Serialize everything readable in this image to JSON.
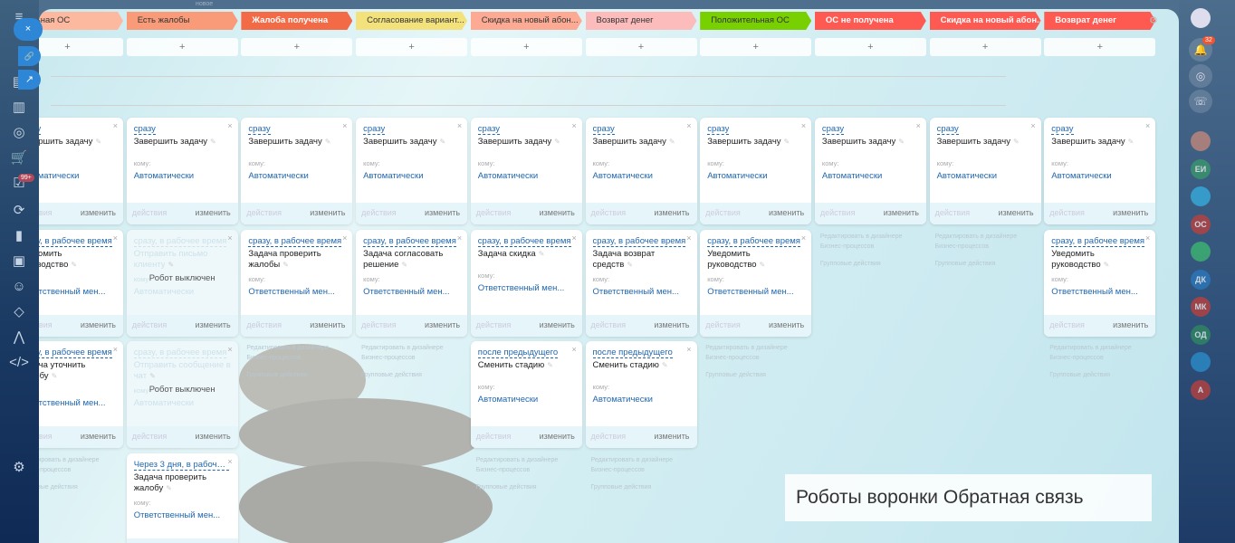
{
  "header_partial": "новое",
  "stages": [
    {
      "label": "тельная ОС",
      "color": "#fdb8a0",
      "text": "#333"
    },
    {
      "label": "Есть жалобы",
      "color": "#f99a78",
      "text": "#333"
    },
    {
      "label": "Жалоба получена",
      "color": "#f36a47",
      "text": "#fff"
    },
    {
      "label": "Согласование вариант...",
      "color": "#f3e27c",
      "text": "#333"
    },
    {
      "label": "Скидка на новый абон...",
      "color": "#fcaa93",
      "text": "#333"
    },
    {
      "label": "Возврат денег",
      "color": "#fcbcbc",
      "text": "#333"
    },
    {
      "label": "Положительная ОС",
      "color": "#78d000",
      "text": "#333"
    },
    {
      "label": "ОС не получена",
      "color": "#ff5a52",
      "text": "#fff"
    },
    {
      "label": "Скидка на новый абон...",
      "color": "#ff5a52",
      "text": "#fff"
    },
    {
      "label": "Возврат денег",
      "color": "#ff5a52",
      "text": "#fff"
    }
  ],
  "add_label": "+",
  "labels": {
    "who": "кому:",
    "actions": "действия",
    "edit": "изменить",
    "off": "Робот выключен",
    "designer": "Редактировать в дизайнере Бизнес-процессов",
    "group": "Групповые действия",
    "close": "×",
    "pen": "✎"
  },
  "columns": [
    [
      {
        "cond": "сразу",
        "title": "Завершить задачу",
        "who": "Автоматически"
      },
      {
        "cond": "сразу, в рабочее время",
        "title": "Уведомить руководство",
        "who": "Ответственный мен..."
      },
      {
        "cond": "сразу, в рабочее время",
        "title": "Задача уточнить жалобу",
        "who": "Ответственный мен..."
      },
      {
        "links": true
      }
    ],
    [
      {
        "cond": "сразу",
        "title": "Завершить задачу",
        "who": "Автоматически"
      },
      {
        "cond": "сразу, в рабочее время",
        "title": "Отправить письмо клиенту",
        "who": "Автоматически",
        "off": true
      },
      {
        "cond": "сразу, в рабочее время",
        "title": "Отправить сообщение в чат",
        "who": "Автоматически",
        "off": true
      },
      {
        "cond": "Через 3 дня, в рабоче...",
        "title": "Задача проверить жалобу",
        "who": "Ответственный мен..."
      }
    ],
    [
      {
        "cond": "сразу",
        "title": "Завершить задачу",
        "who": "Автоматически"
      },
      {
        "cond": "сразу, в рабочее время",
        "title": "Задача проверить жалобы",
        "who": "Ответственный мен..."
      },
      {
        "links": true
      }
    ],
    [
      {
        "cond": "сразу",
        "title": "Завершить задачу",
        "who": "Автоматически"
      },
      {
        "cond": "сразу, в рабочее время",
        "title": "Задача согласовать решение",
        "who": "Ответственный мен..."
      },
      {
        "links": true
      }
    ],
    [
      {
        "cond": "сразу",
        "title": "Завершить задачу",
        "who": "Автоматически"
      },
      {
        "cond": "сразу, в рабочее время",
        "title": "Задача скидка",
        "who": "Ответственный мен..."
      },
      {
        "cond": "после предыдущего",
        "title": "Сменить стадию",
        "who": "Автоматически"
      },
      {
        "links": true
      }
    ],
    [
      {
        "cond": "сразу",
        "title": "Завершить задачу",
        "who": "Автоматически"
      },
      {
        "cond": "сразу, в рабочее время",
        "title": "Задача возврат средств",
        "who": "Ответственный мен..."
      },
      {
        "cond": "после предыдущего",
        "title": "Сменить стадию",
        "who": "Автоматически"
      },
      {
        "links": true
      }
    ],
    [
      {
        "cond": "сразу",
        "title": "Завершить задачу",
        "who": "Автоматически"
      },
      {
        "cond": "сразу, в рабочее время",
        "title": "Уведомить руководство",
        "who": "Ответственный мен..."
      },
      {
        "links": true
      }
    ],
    [
      {
        "cond": "сразу",
        "title": "Завершить задачу",
        "who": "Автоматически"
      },
      {
        "links": true
      }
    ],
    [
      {
        "cond": "сразу",
        "title": "Завершить задачу",
        "who": "Автоматически"
      },
      {
        "links": true
      }
    ],
    [
      {
        "cond": "сразу",
        "title": "Завершить задачу",
        "who": "Автоматически"
      },
      {
        "cond": "сразу, в рабочее время",
        "title": "Уведомить руководство",
        "who": "Ответственный мен..."
      },
      {
        "links": true
      }
    ]
  ],
  "caption": "Роботы воронки Обратная связь",
  "left_badge": "99+",
  "notifications_count": "32",
  "avatars": [
    {
      "initials": "",
      "color": "#c98a7a"
    },
    {
      "initials": "ЕИ",
      "color": "#3a9a6a"
    },
    {
      "initials": "",
      "color": "#36b0e0"
    },
    {
      "initials": "ОС",
      "color": "#c0403a"
    },
    {
      "initials": "",
      "color": "#3dbb70"
    },
    {
      "initials": "ДК",
      "color": "#2a7ac0"
    },
    {
      "initials": "МК",
      "color": "#c0403a"
    },
    {
      "initials": "ОД",
      "color": "#2f8a60"
    },
    {
      "initials": "",
      "color": "#2a90d0"
    },
    {
      "initials": "А",
      "color": "#c0403a"
    }
  ],
  "icons": {
    "close": "×",
    "link": "🔗",
    "external": "↗"
  }
}
